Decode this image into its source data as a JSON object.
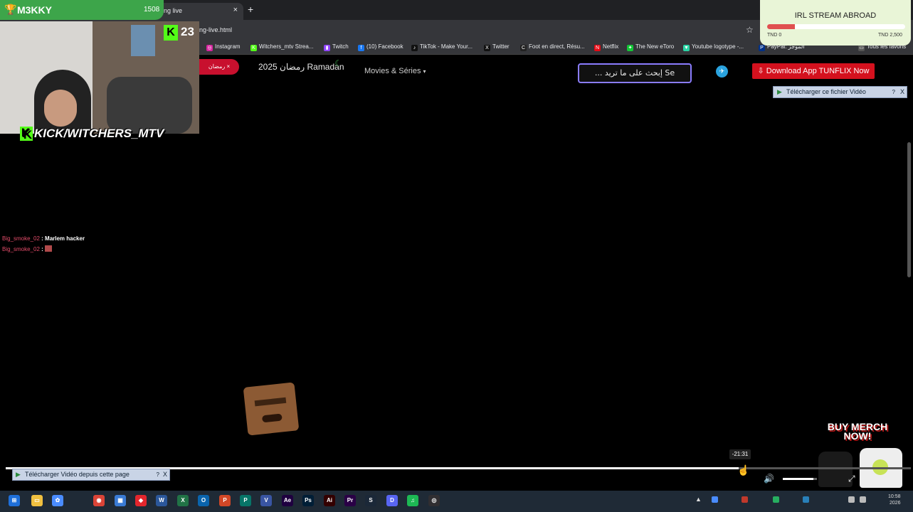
{
  "browser": {
    "tab_title": "ng live",
    "url": "ng-live.html",
    "new_tab": "+",
    "close_tab": "×",
    "bookmarks": [
      {
        "label": "Instagram",
        "icon": "instagram-icon",
        "color": "#d6249f",
        "glyph": "◎"
      },
      {
        "label": "Witchers_mtv Strea...",
        "icon": "kick-icon",
        "color": "#53fc18",
        "glyph": "K"
      },
      {
        "label": "Twitch",
        "icon": "twitch-icon",
        "color": "#9146ff",
        "glyph": "▮"
      },
      {
        "label": "(10) Facebook",
        "icon": "facebook-icon",
        "color": "#1877f2",
        "glyph": "f"
      },
      {
        "label": "TikTok - Make Your...",
        "icon": "tiktok-icon",
        "color": "#111111",
        "glyph": "♪"
      },
      {
        "label": "Twitter",
        "icon": "x-icon",
        "color": "#111111",
        "glyph": "X"
      },
      {
        "label": "Foot en direct, Résu...",
        "icon": "foot-icon",
        "color": "#222222",
        "glyph": "C"
      },
      {
        "label": "Netflix",
        "icon": "netflix-icon",
        "color": "#e50914",
        "glyph": "N"
      },
      {
        "label": "The New eToro",
        "icon": "etoro-icon",
        "color": "#13c636",
        "glyph": "✦"
      },
      {
        "label": "Youtube logotype -...",
        "icon": "vector-icon",
        "color": "#2ad4a5",
        "glyph": "▼"
      },
      {
        "label": "PayPal: الموجز",
        "icon": "paypal-icon",
        "color": "#003087",
        "glyph": "P"
      },
      {
        "label": "Tous les favoris",
        "icon": "folder-icon",
        "color": "#555555",
        "glyph": "▭"
      }
    ]
  },
  "site": {
    "ramadan_pill": "رمضان ×",
    "ramadan_title": "2025 رمضان Ramadan",
    "moon": "☾",
    "nav_movies": "Movies & Séries",
    "nav_caret": "▾",
    "search_placeholder": "... إبحث على ما تريد Se",
    "telegram": "✈",
    "download_app": "Download App TUNFLIX Now",
    "download_app_icon": "⇩",
    "file_download": "Télécharger ce fichier Vidéo",
    "file_download_q": "?",
    "file_download_close": "X"
  },
  "stream": {
    "streamer": "M3KKY",
    "streamer_count": "1508",
    "kick_viewers": "23",
    "kick_logo": "K",
    "kick_handle": "KICK/WITCHERS_MTV",
    "chat": [
      {
        "user": "Big_smoke_02",
        "message": "Marlem hacker"
      },
      {
        "user": "Big_smoke_02",
        "message": ""
      }
    ],
    "goal_title": "IRL STREAM ABROAD",
    "goal_min": "TND 0",
    "goal_max": "TND 2,500",
    "goal_progress": 0.2,
    "merch": "BUY MERCH NOW!"
  },
  "player": {
    "time_tooltip": "-21:31",
    "progress": 0.81,
    "volume": 0.9,
    "page_download": "Télécharger Vidéo depuis cette page",
    "page_download_q": "?",
    "page_download_close": "X",
    "volume_icon": "🔊",
    "fullscreen_icon": "⤢"
  },
  "taskbar": {
    "apps": [
      {
        "name": "file-explorer-icon",
        "color": "#f0c040",
        "glyph": "▭"
      },
      {
        "name": "copilot-icon",
        "color": "#4a8cff",
        "glyph": "✿"
      },
      {
        "name": "chrome-icon",
        "color": "#db4437",
        "glyph": "◉"
      },
      {
        "name": "store-icon",
        "color": "#3a7bd5",
        "glyph": "▦"
      },
      {
        "name": "anydesk-icon",
        "color": "#e3262d",
        "glyph": "◆"
      },
      {
        "name": "word-icon",
        "color": "#2b579a",
        "glyph": "W"
      },
      {
        "name": "excel-icon",
        "color": "#217346",
        "glyph": "X"
      },
      {
        "name": "outlook-icon",
        "color": "#0a64ad",
        "glyph": "O"
      },
      {
        "name": "powerpoint-icon",
        "color": "#d24726",
        "glyph": "P"
      },
      {
        "name": "publisher-icon",
        "color": "#077568",
        "glyph": "P"
      },
      {
        "name": "visio-icon",
        "color": "#3955a3",
        "glyph": "V"
      },
      {
        "name": "after-effects-icon",
        "color": "#1f0040",
        "glyph": "Ae"
      },
      {
        "name": "photoshop-icon",
        "color": "#001e36",
        "glyph": "Ps"
      },
      {
        "name": "illustrator-icon",
        "color": "#330000",
        "glyph": "Ai"
      },
      {
        "name": "premiere-icon",
        "color": "#2a0046",
        "glyph": "Pr"
      },
      {
        "name": "steam-icon",
        "color": "#1b2838",
        "glyph": "S"
      },
      {
        "name": "discord-icon",
        "color": "#5865f2",
        "glyph": "D"
      },
      {
        "name": "spotify-icon",
        "color": "#1db954",
        "glyph": "♫"
      },
      {
        "name": "obs-icon",
        "color": "#302e31",
        "glyph": "◎"
      }
    ],
    "clock_time": "10:58",
    "clock_date": "2026"
  }
}
